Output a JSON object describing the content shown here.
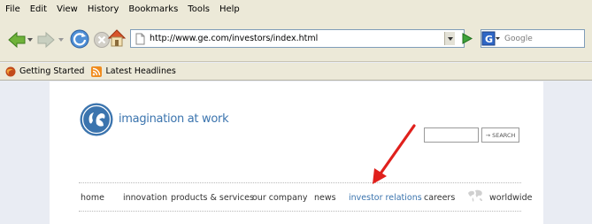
{
  "menu": [
    "File",
    "Edit",
    "View",
    "History",
    "Bookmarks",
    "Tools",
    "Help"
  ],
  "toolbar": {
    "url": "http://www.ge.com/investors/index.html",
    "search_placeholder": "Google"
  },
  "bookmarks": [
    "Getting Started",
    "Latest Headlines"
  ],
  "page": {
    "tagline": "imagination at work",
    "search_button": "→ SEARCH",
    "nav": [
      "home",
      "innovation",
      "products & services",
      "our company",
      "news",
      "investor relations",
      "careers",
      "worldwide"
    ],
    "active_nav": "investor relations"
  },
  "colors": {
    "chrome": "#ece9d8",
    "ge_blue": "#3b74ae",
    "annotation_arrow": "#e0201c"
  }
}
